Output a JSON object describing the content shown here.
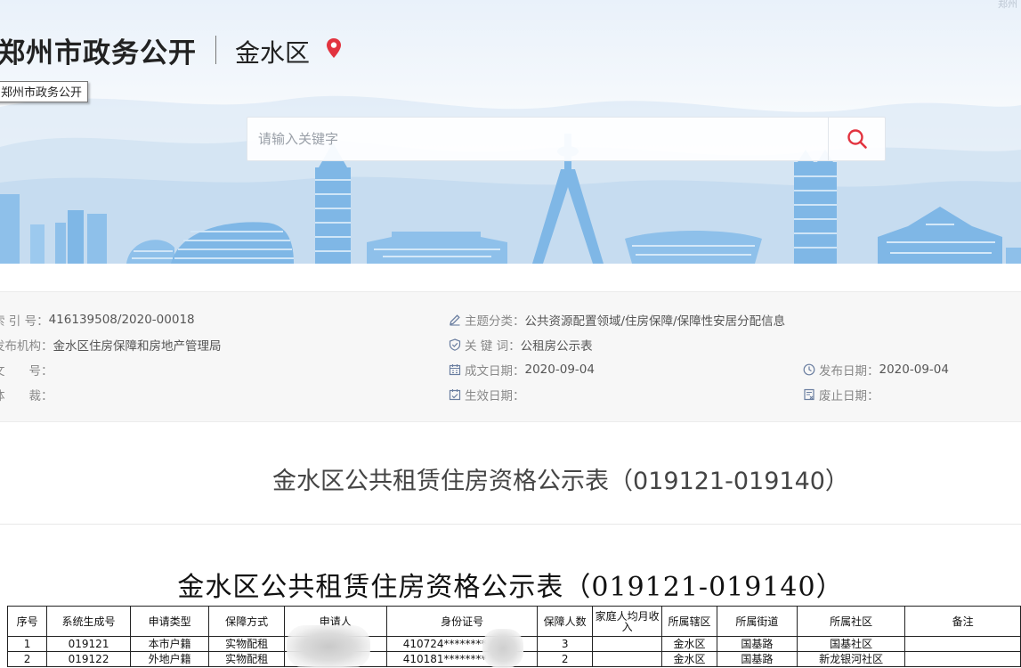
{
  "header": {
    "site_title": "郑州市政务公开",
    "district": "金水区",
    "tooltip": "郑州市政务公开",
    "corner_text": "郑州"
  },
  "search": {
    "placeholder": "请输入关键字"
  },
  "meta": {
    "index_no": {
      "label": "索 引 号：",
      "value": "416139508/2020-00018"
    },
    "publisher": {
      "label": "发布机构：",
      "value": "金水区住房保障和房地产管理局"
    },
    "doc_no": {
      "label": "文　　号：",
      "value": ""
    },
    "genre": {
      "label": "体　　裁：",
      "value": ""
    },
    "topic": {
      "label": "主题分类：",
      "value": "公共资源配置领域/住房保障/保障性安居分配信息"
    },
    "keywords": {
      "label": "关 键 词：",
      "value": "公租房公示表"
    },
    "written_date": {
      "label": "成文日期：",
      "value": "2020-09-04"
    },
    "effective_date": {
      "label": "生效日期：",
      "value": ""
    },
    "publish_date": {
      "label": "发布日期：",
      "value": "2020-09-04"
    },
    "expire_date": {
      "label": "废止日期：",
      "value": ""
    }
  },
  "page_heading": "金水区公共租赁住房资格公示表（019121-019140）",
  "doc_title": "金水区公共租赁住房资格公示表（019121-019140）",
  "table": {
    "headers": [
      "序号",
      "系统生成号",
      "申请类型",
      "保障方式",
      "申请人",
      "身份证号",
      "保障人数",
      "家庭人均月收入",
      "所属辖区",
      "所属街道",
      "所属社区",
      "备注"
    ],
    "rows": [
      [
        "1",
        "019121",
        "本市户籍",
        "实物配租",
        "",
        "410724********",
        "3",
        "",
        "金水区",
        "国基路",
        "国基社区",
        ""
      ],
      [
        "2",
        "019122",
        "外地户籍",
        "实物配租",
        "",
        "410181********",
        "2",
        "",
        "金水区",
        "国基路",
        "新龙银河社区",
        ""
      ]
    ]
  },
  "colors": {
    "accent": "#e2333f",
    "banner_blue": "#7fb7e6",
    "meta_bg": "#f7f7f7"
  },
  "icons": [
    "location-pin-icon",
    "search-icon",
    "pencil-icon",
    "shield-check-icon",
    "calendar-icon",
    "clock-icon",
    "calendar-check-icon",
    "document-x-icon"
  ]
}
